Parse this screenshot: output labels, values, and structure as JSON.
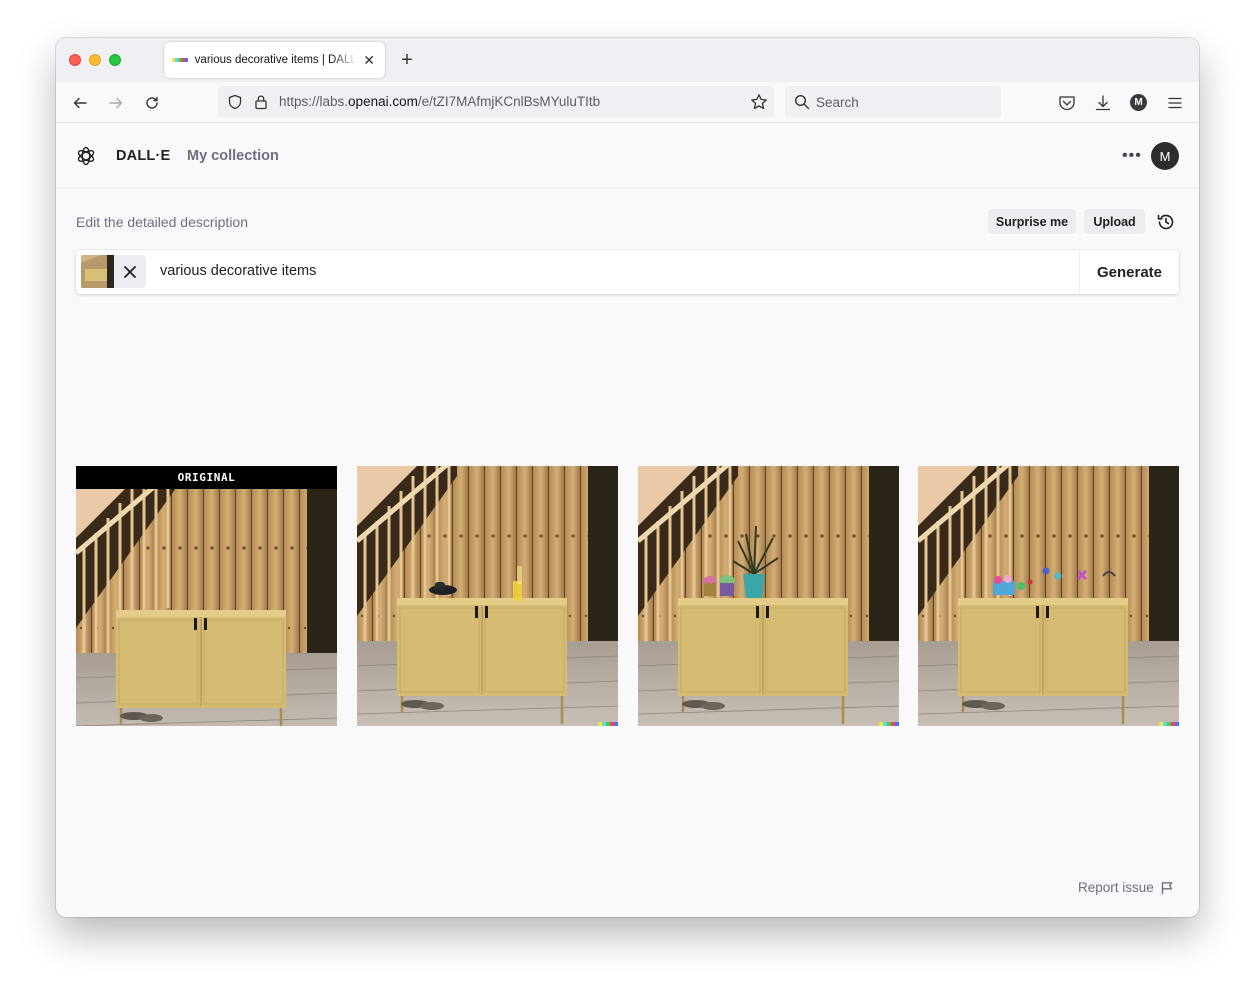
{
  "browser": {
    "tab_title": "various decorative items | DALL·E",
    "url_prefix": "https://labs.",
    "url_domain": "openai.com",
    "url_path": "/e/tZI7MAfmjKCnlBsMYuluTItb",
    "search_placeholder": "Search",
    "account_initial": "M"
  },
  "app": {
    "brand": "DALL·E",
    "nav_collection": "My collection",
    "avatar_initial": "M"
  },
  "prompt": {
    "label": "Edit the detailed description",
    "surprise_label": "Surprise me",
    "upload_label": "Upload",
    "text": "various decorative items",
    "generate_label": "Generate"
  },
  "results": {
    "original_label": "ORIGINAL",
    "variations": [
      {
        "decor": "dark-vessel-and-yellow-object"
      },
      {
        "decor": "plant-and-cupcakes"
      },
      {
        "decor": "colorful-small-figures"
      }
    ]
  },
  "footer": {
    "report_label": "Report issue"
  },
  "colors": {
    "window_bg": "#f9f9fb",
    "cabinet": "#d6bc72",
    "signature": [
      "#f5e342",
      "#59e0d8",
      "#4fc45a",
      "#e8484d",
      "#4a6ef0"
    ]
  }
}
